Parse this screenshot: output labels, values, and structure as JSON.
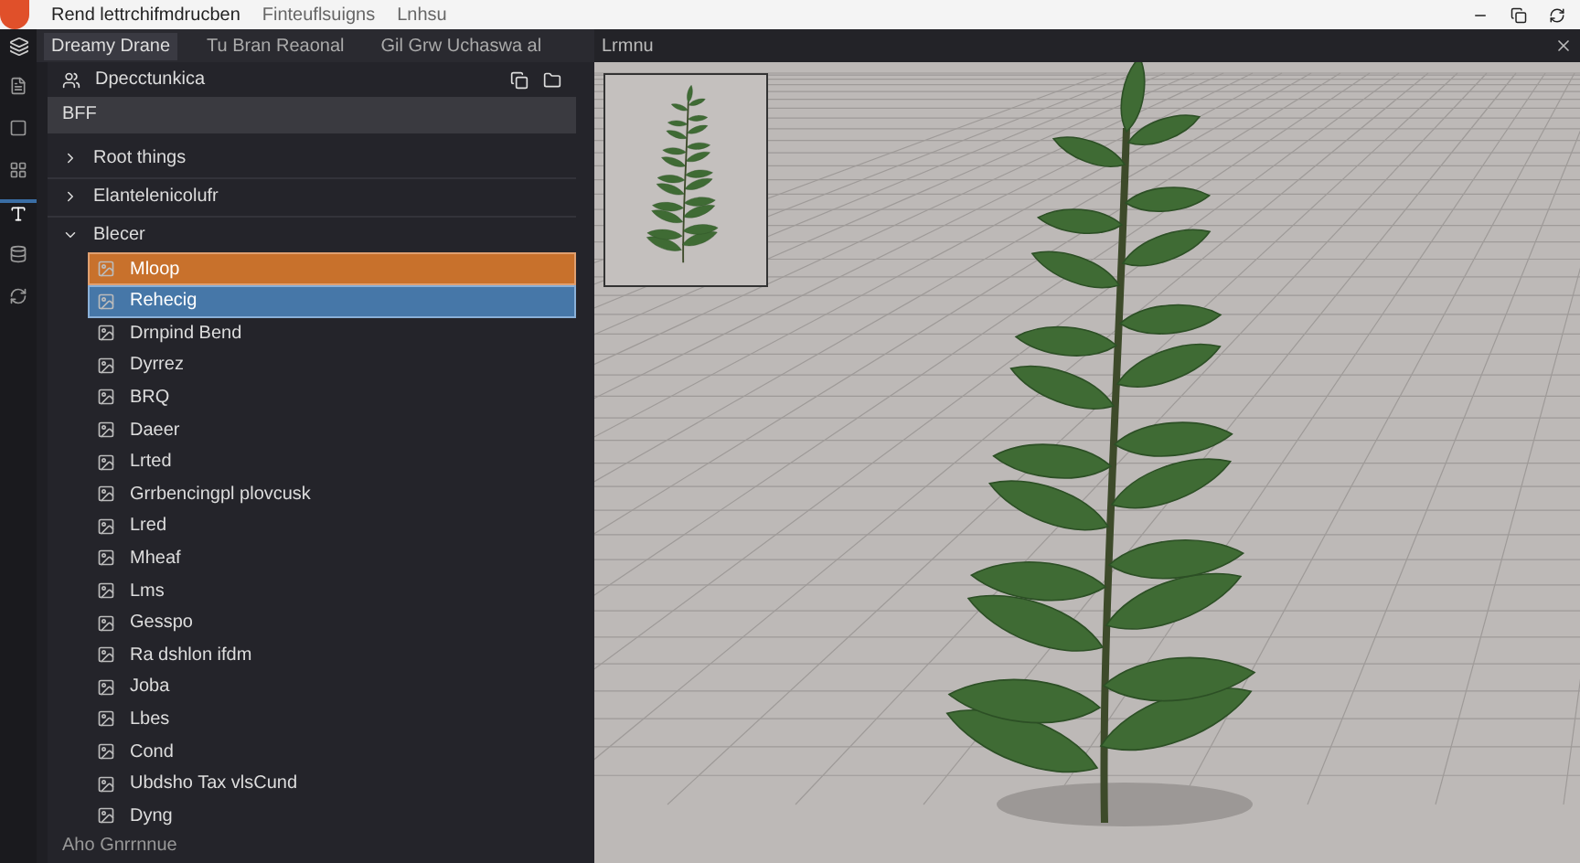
{
  "title_bar": {
    "title": "Rend lettrchifmdrucben",
    "menus": [
      "Finteuflsuigns",
      "Lnhsu"
    ]
  },
  "toolbar": {
    "tabs": [
      {
        "label": "Dreamy Drane",
        "selected": true
      },
      {
        "label": "Tu Bran Reaonal",
        "selected": false
      },
      {
        "label": "Gil Grw Uchaswa al",
        "selected": false
      }
    ],
    "viewport_label": "Lrmnu"
  },
  "rail": {
    "items": [
      {
        "selected": false
      },
      {
        "selected": false
      },
      {
        "selected": false
      },
      {
        "selected": true
      },
      {
        "selected": false
      },
      {
        "selected": false
      }
    ]
  },
  "panel": {
    "title": "Dpecctunkica",
    "filter": "BFF",
    "sections": [
      {
        "label": "Root things",
        "expanded": false
      },
      {
        "label": "Elantelenicolufr",
        "expanded": false
      }
    ],
    "group": {
      "label": "Blecer",
      "expanded": true,
      "children": [
        {
          "label": "Mloop",
          "selected": true,
          "hovered": false
        },
        {
          "label": "Rehecig",
          "selected": false,
          "hovered": true
        },
        {
          "label": "Drnpind Bend",
          "selected": false,
          "hovered": false
        },
        {
          "label": "Dyrrez",
          "selected": false,
          "hovered": false
        },
        {
          "label": "BRQ",
          "selected": false,
          "hovered": false
        },
        {
          "label": "Daeer",
          "selected": false,
          "hovered": false
        },
        {
          "label": "Lrted",
          "selected": false,
          "hovered": false
        },
        {
          "label": "Grrbencingpl plovcusk",
          "selected": false,
          "hovered": false
        },
        {
          "label": "Lred",
          "selected": false,
          "hovered": false
        },
        {
          "label": "Mheaf",
          "selected": false,
          "hovered": false
        },
        {
          "label": "Lms",
          "selected": false,
          "hovered": false
        },
        {
          "label": "Gesspo",
          "selected": false,
          "hovered": false
        },
        {
          "label": "Ra dshlon ifdm",
          "selected": false,
          "hovered": false
        },
        {
          "label": "Joba",
          "selected": false,
          "hovered": false
        },
        {
          "label": "Lbes",
          "selected": false,
          "hovered": false
        },
        {
          "label": "Cond",
          "selected": false,
          "hovered": false
        },
        {
          "label": "Ubdsho Tax vlsCund",
          "selected": false,
          "hovered": false
        },
        {
          "label": "Dyng",
          "selected": false,
          "hovered": false
        }
      ]
    },
    "footer": "Aho Gnrrnnue"
  }
}
